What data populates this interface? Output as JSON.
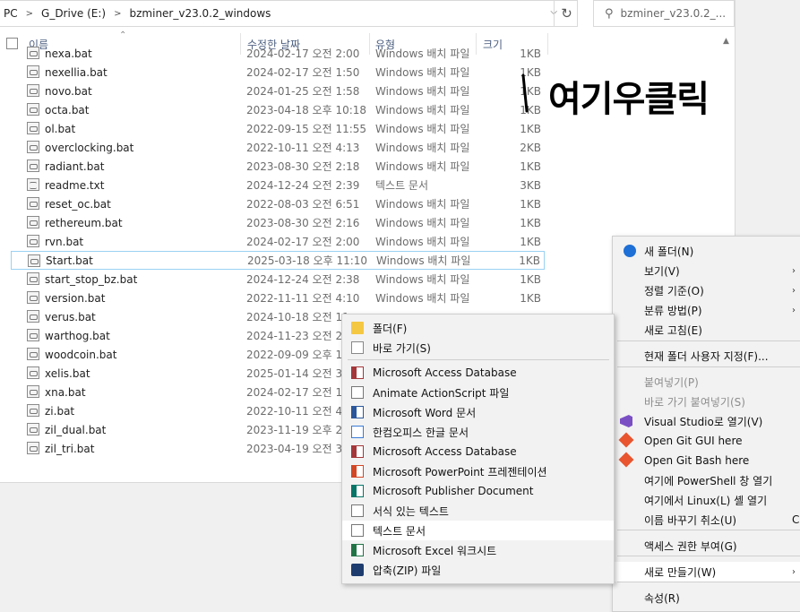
{
  "address": {
    "crumbs": [
      "PC",
      "G_Drive (E:)",
      "bzminer_v23.0.2_windows"
    ],
    "search_placeholder": "bzminer_v23.0.2_..."
  },
  "columns": {
    "name": "이름",
    "date": "수정한 날짜",
    "type": "유형",
    "size": "크기"
  },
  "files": [
    {
      "name": "nexa.bat",
      "date": "2024-02-17 오전 2:00",
      "type": "Windows 배치 파일",
      "size": "1KB"
    },
    {
      "name": "nexellia.bat",
      "date": "2024-02-17 오전 1:50",
      "type": "Windows 배치 파일",
      "size": "1KB"
    },
    {
      "name": "novo.bat",
      "date": "2024-01-25 오전 1:58",
      "type": "Windows 배치 파일",
      "size": "1KB"
    },
    {
      "name": "octa.bat",
      "date": "2023-04-18 오후 10:18",
      "type": "Windows 배치 파일",
      "size": "1KB"
    },
    {
      "name": "ol.bat",
      "date": "2022-09-15 오전 11:55",
      "type": "Windows 배치 파일",
      "size": "1KB"
    },
    {
      "name": "overclocking.bat",
      "date": "2022-10-11 오전 4:13",
      "type": "Windows 배치 파일",
      "size": "2KB"
    },
    {
      "name": "radiant.bat",
      "date": "2023-08-30 오전 2:18",
      "type": "Windows 배치 파일",
      "size": "1KB"
    },
    {
      "name": "readme.txt",
      "date": "2024-12-24 오전 2:39",
      "type": "텍스트 문서",
      "size": "3KB"
    },
    {
      "name": "reset_oc.bat",
      "date": "2022-08-03 오전 6:51",
      "type": "Windows 배치 파일",
      "size": "1KB"
    },
    {
      "name": "rethereum.bat",
      "date": "2023-08-30 오전 2:16",
      "type": "Windows 배치 파일",
      "size": "1KB"
    },
    {
      "name": "rvn.bat",
      "date": "2024-02-17 오전 2:00",
      "type": "Windows 배치 파일",
      "size": "1KB"
    },
    {
      "name": "Start.bat",
      "date": "2025-03-18 오후 11:10",
      "type": "Windows 배치 파일",
      "size": "1KB"
    },
    {
      "name": "start_stop_bz.bat",
      "date": "2024-12-24 오전 2:38",
      "type": "Windows 배치 파일",
      "size": "1KB"
    },
    {
      "name": "version.bat",
      "date": "2022-11-11 오전 4:10",
      "type": "Windows 배치 파일",
      "size": "1KB"
    },
    {
      "name": "verus.bat",
      "date": "2024-10-18 오전 11",
      "type": "",
      "size": ""
    },
    {
      "name": "warthog.bat",
      "date": "2024-11-23 오전 2",
      "type": "",
      "size": ""
    },
    {
      "name": "woodcoin.bat",
      "date": "2022-09-09 오후 1",
      "type": "",
      "size": ""
    },
    {
      "name": "xelis.bat",
      "date": "2025-01-14 오전 3",
      "type": "",
      "size": ""
    },
    {
      "name": "xna.bat",
      "date": "2024-02-17 오전 1",
      "type": "",
      "size": ""
    },
    {
      "name": "zi.bat",
      "date": "2022-10-11 오전 4",
      "type": "",
      "size": ""
    },
    {
      "name": "zil_dual.bat",
      "date": "2023-11-19 오후 2",
      "type": "",
      "size": ""
    },
    {
      "name": "zil_tri.bat",
      "date": "2023-04-19 오전 3",
      "type": "",
      "size": ""
    }
  ],
  "annotation": {
    "text": "여기우클릭"
  },
  "context_menu": {
    "items": [
      {
        "label": "새 폴더(N)",
        "icon": "new-folder-icon"
      },
      {
        "label": "보기(V)"
      },
      {
        "label": "정렬 기준(O)"
      },
      {
        "label": "분류 방법(P)"
      },
      {
        "label": "새로 고침(E)"
      },
      {
        "label": "현재 폴더 사용자 지정(F)..."
      },
      {
        "label": "붙여넣기(P)",
        "disabled": true
      },
      {
        "label": "바로 가기 붙여넣기(S)",
        "disabled": true
      },
      {
        "label": "Visual Studio로 열기(V)",
        "icon": "visual-studio-icon"
      },
      {
        "label": "Open Git GUI here",
        "icon": "git-icon"
      },
      {
        "label": "Open Git Bash here",
        "icon": "git-icon"
      },
      {
        "label": "여기에 PowerShell 창 열기"
      },
      {
        "label": "여기에서 Linux(L) 셸 열기"
      },
      {
        "label": "이름 바꾸기 취소(U)",
        "shortcut": "C"
      },
      {
        "label": "액세스 권한 부여(G)"
      },
      {
        "label": "새로 만들기(W)",
        "highlighted": true
      },
      {
        "label": "속성(R)"
      }
    ]
  },
  "submenu": {
    "items": [
      {
        "label": "폴더(F)",
        "icon": "folder-icon"
      },
      {
        "label": "바로 가기(S)",
        "icon": "shortcut-icon"
      },
      {
        "label": "Microsoft Access Database",
        "icon": "access-icon"
      },
      {
        "label": "Animate ActionScript 파일",
        "icon": "actionscript-icon"
      },
      {
        "label": "Microsoft Word 문서",
        "icon": "word-icon"
      },
      {
        "label": "한컴오피스 한글 문서",
        "icon": "hwp-icon"
      },
      {
        "label": "Microsoft Access Database",
        "icon": "access-icon"
      },
      {
        "label": "Microsoft PowerPoint 프레젠테이션",
        "icon": "powerpoint-icon"
      },
      {
        "label": "Microsoft Publisher Document",
        "icon": "publisher-icon"
      },
      {
        "label": "서식 있는 텍스트",
        "icon": "rtf-icon"
      },
      {
        "label": "텍스트 문서",
        "icon": "text-doc-icon",
        "highlighted": true
      },
      {
        "label": "Microsoft Excel 워크시트",
        "icon": "excel-icon"
      },
      {
        "label": "압축(ZIP) 파일",
        "icon": "zip-icon"
      }
    ]
  },
  "colors": {
    "selection_border": "#99d1f3",
    "header_text": "#4d6082",
    "menu_bg": "#f2f2f2"
  }
}
